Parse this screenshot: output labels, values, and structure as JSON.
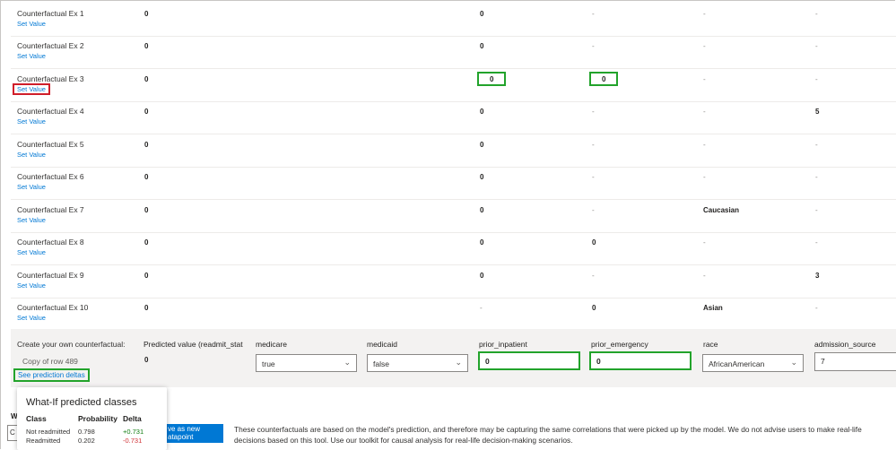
{
  "set_value_label": "Set Value",
  "rows": [
    {
      "name": "Counterfactual Ex 1",
      "pred": "0",
      "prior_inpatient": "0",
      "prior_emergency": "-",
      "race": "-",
      "admission_source": "-"
    },
    {
      "name": "Counterfactual Ex 2",
      "pred": "0",
      "prior_inpatient": "0",
      "prior_emergency": "-",
      "race": "-",
      "admission_source": "-"
    },
    {
      "name": "Counterfactual Ex 3",
      "pred": "0",
      "prior_inpatient": "0",
      "prior_emergency": "0",
      "race": "-",
      "admission_source": "-"
    },
    {
      "name": "Counterfactual Ex 4",
      "pred": "0",
      "prior_inpatient": "0",
      "prior_emergency": "-",
      "race": "-",
      "admission_source": "5"
    },
    {
      "name": "Counterfactual Ex 5",
      "pred": "0",
      "prior_inpatient": "0",
      "prior_emergency": "-",
      "race": "-",
      "admission_source": "-"
    },
    {
      "name": "Counterfactual Ex 6",
      "pred": "0",
      "prior_inpatient": "0",
      "prior_emergency": "-",
      "race": "-",
      "admission_source": "-"
    },
    {
      "name": "Counterfactual Ex 7",
      "pred": "0",
      "prior_inpatient": "0",
      "prior_emergency": "-",
      "race": "Caucasian",
      "admission_source": "-"
    },
    {
      "name": "Counterfactual Ex 8",
      "pred": "0",
      "prior_inpatient": "0",
      "prior_emergency": "0",
      "race": "-",
      "admission_source": "-"
    },
    {
      "name": "Counterfactual Ex 9",
      "pred": "0",
      "prior_inpatient": "0",
      "prior_emergency": "-",
      "race": "-",
      "admission_source": "3"
    },
    {
      "name": "Counterfactual Ex 10",
      "pred": "0",
      "prior_inpatient": "-",
      "prior_emergency": "0",
      "race": "Asian",
      "admission_source": "-"
    }
  ],
  "custom": {
    "title": "Create your own counterfactual:",
    "copy_label": "Copy of row 489",
    "deltas_link": "See prediction deltas",
    "pred_header": "Predicted value (readmit_stat",
    "pred_value": "0",
    "medicare_header": "medicare",
    "medicare_value": "true",
    "medicaid_header": "medicaid",
    "medicaid_value": "false",
    "prior_inpatient_header": "prior_inpatient",
    "prior_inpatient_value": "0",
    "prior_emergency_header": "prior_emergency",
    "prior_emergency_value": "0",
    "race_header": "race",
    "race_value": "AfricanAmerican",
    "admission_source_header": "admission_source",
    "admission_source_value": "7"
  },
  "tooltip": {
    "title": "What-If predicted classes",
    "headers": {
      "class": "Class",
      "probability": "Probability",
      "delta": "Delta"
    },
    "rows": [
      {
        "class": "Not readmitted",
        "probability": "0.798",
        "delta": "+0.731"
      },
      {
        "class": "Readmitted",
        "probability": "0.202",
        "delta": "-0.731"
      }
    ]
  },
  "save_button": {
    "line1": "ve as new",
    "line2": "atapoint"
  },
  "bottom_left_fragment": "W",
  "bottom_input_fragment": "C",
  "disclaimer": "These counterfactuals are based on the model's prediction, and therefore may be capturing the same correlations that were picked up by the model. We do not advise users to make real-life decisions based on this tool. Use our toolkit for causal analysis for real-life decision-making scenarios.",
  "colors": {
    "link": "#0078d4",
    "highlight_red": "#d01e2a",
    "highlight_green": "#22a32b",
    "positive": "#107c10",
    "negative": "#d13438"
  }
}
